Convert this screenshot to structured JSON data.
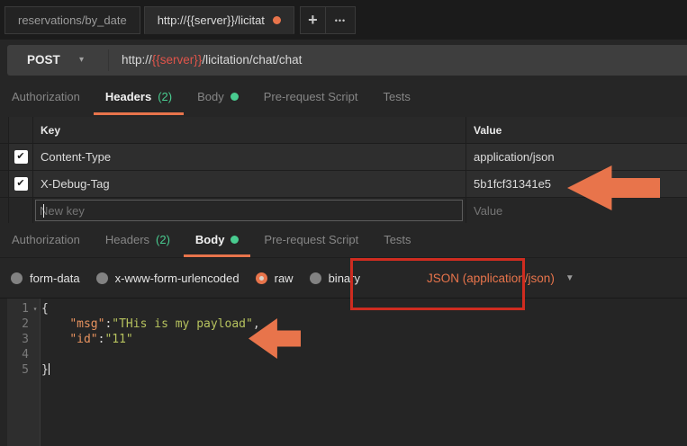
{
  "window": {
    "tabs": [
      {
        "label": "reservations/by_date",
        "active": false,
        "dot": false
      },
      {
        "label": "http://{{server}}/licitat",
        "active": true,
        "dot": true
      }
    ],
    "new_tab_label": "+",
    "more_tabs_label": "•••"
  },
  "request_bar": {
    "method": "POST",
    "method_chevron": "▾",
    "url": {
      "prefix": "http://",
      "variable": "{{server}}",
      "path": "/licitation/chat/chat"
    }
  },
  "headers_panel": {
    "tabs": [
      {
        "label": "Authorization"
      },
      {
        "label": "Headers",
        "count": "(2)",
        "active": true
      },
      {
        "label": "Body",
        "dot": true
      },
      {
        "label": "Pre-request Script"
      },
      {
        "label": "Tests"
      }
    ],
    "table": {
      "key_header": "Key",
      "value_header": "Value",
      "rows": [
        {
          "checked": true,
          "check_glyph": "✔",
          "key": "Content-Type",
          "value": "application/json"
        },
        {
          "checked": true,
          "check_glyph": "✔",
          "key": "X-Debug-Tag",
          "value": "5b1fcf31341e5"
        }
      ],
      "new_key_placeholder": "New key",
      "new_value_placeholder": "Value"
    }
  },
  "body_panel": {
    "tabs": [
      {
        "label": "Authorization"
      },
      {
        "label": "Headers",
        "count": "(2)"
      },
      {
        "label": "Body",
        "dot": true,
        "active": true
      },
      {
        "label": "Pre-request Script"
      },
      {
        "label": "Tests"
      }
    ],
    "modes": [
      {
        "label": "form-data",
        "selected": false
      },
      {
        "label": "x-www-form-urlencoded",
        "selected": false
      },
      {
        "label": "raw",
        "selected": true
      },
      {
        "label": "binary",
        "selected": false
      }
    ],
    "content_type": "JSON (application/json)",
    "content_type_chevron": "▼",
    "editor": {
      "fold_glyph": "▾",
      "lines": [
        {
          "num": "1",
          "fold": true,
          "tokens": [
            {
              "text": "{",
              "type": "plain"
            }
          ]
        },
        {
          "num": "2",
          "tokens": [
            {
              "text": "    ",
              "type": "plain"
            },
            {
              "text": "\"msg\"",
              "type": "key"
            },
            {
              "text": ":",
              "type": "plain"
            },
            {
              "text": "\"THis is my payload\"",
              "type": "string"
            },
            {
              "text": ",",
              "type": "plain"
            }
          ]
        },
        {
          "num": "3",
          "tokens": [
            {
              "text": "    ",
              "type": "plain"
            },
            {
              "text": "\"id\"",
              "type": "key"
            },
            {
              "text": ":",
              "type": "plain"
            },
            {
              "text": "\"11\"",
              "type": "string"
            }
          ]
        },
        {
          "num": "4",
          "tokens": []
        },
        {
          "num": "5",
          "tokens": [
            {
              "text": "}",
              "type": "plain"
            }
          ],
          "cursor": true
        }
      ]
    }
  },
  "colors": {
    "accent_orange": "#e8744b",
    "count_green": "#49cc90",
    "variable_red": "#e0544a",
    "json_key_orange": "#e8935f",
    "json_string_green": "#b6c25e",
    "annotation_red": "#cf2c20",
    "annotation_arrow_orange": "#e8744b"
  }
}
